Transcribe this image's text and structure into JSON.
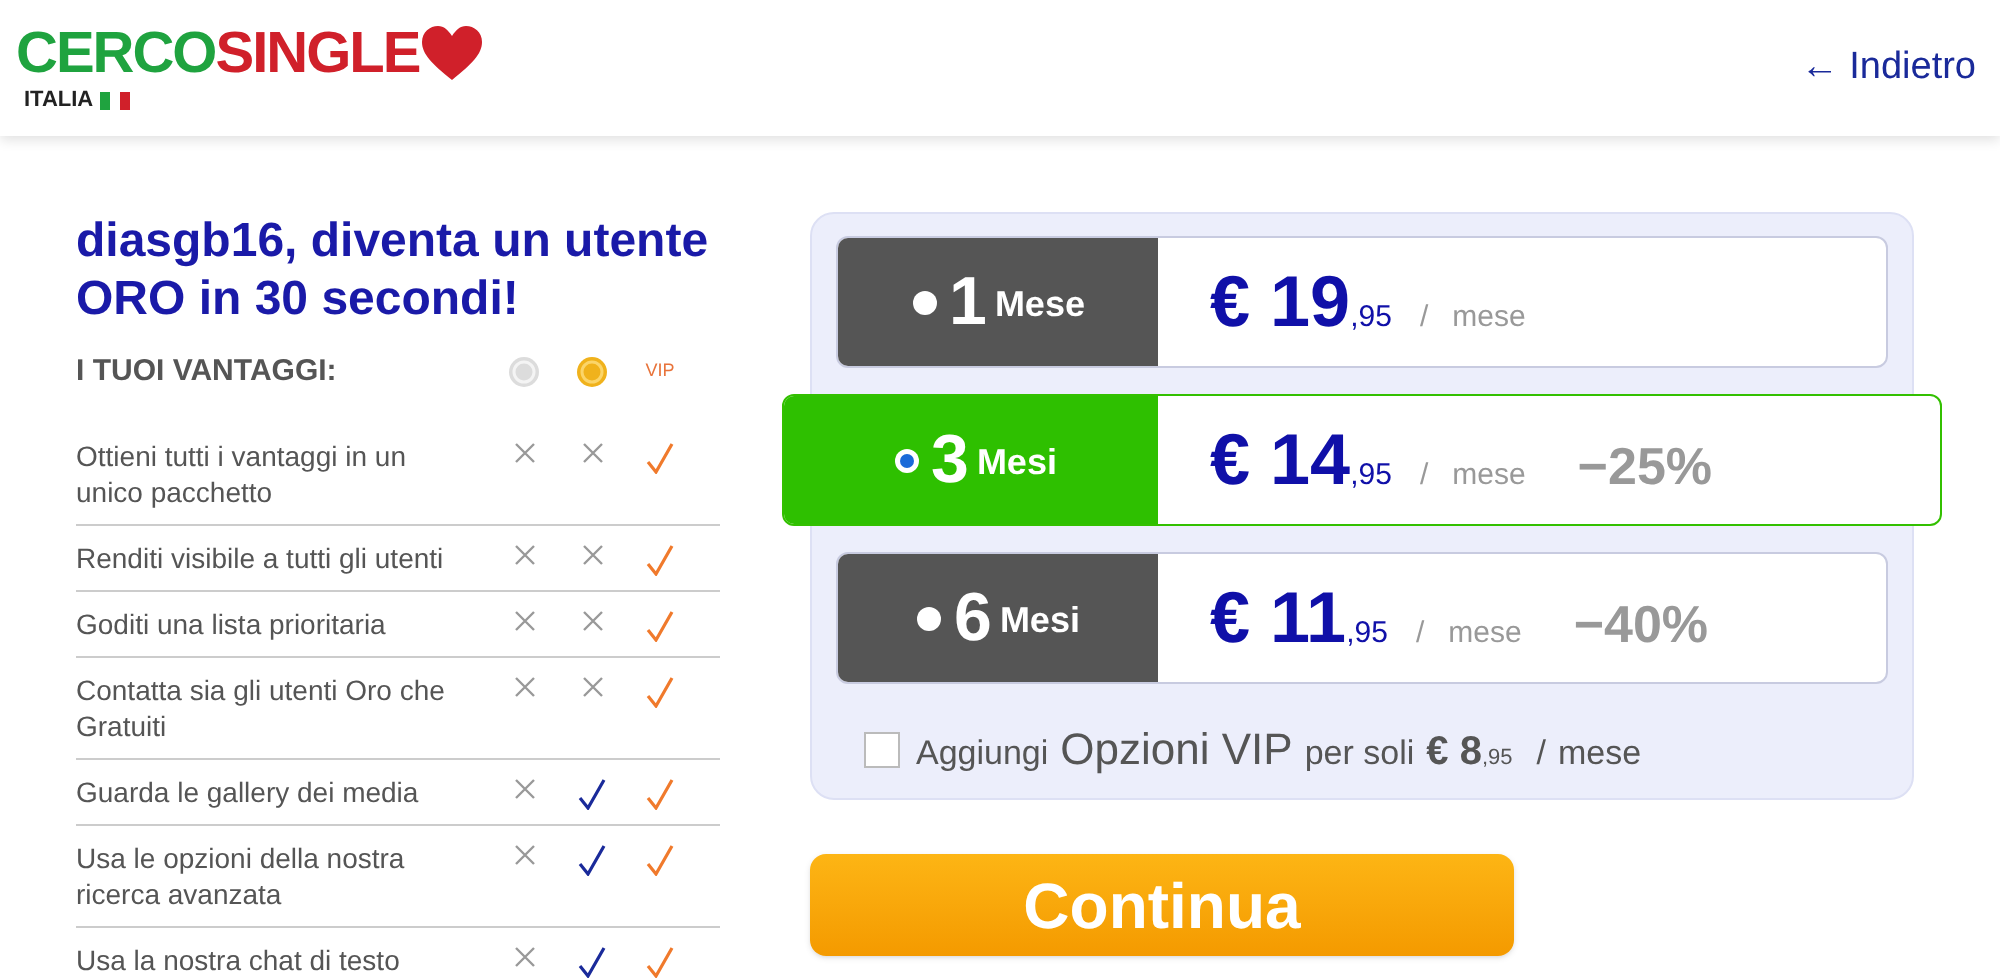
{
  "header": {
    "logo": {
      "part1": "CERCO",
      "part2": "SINGLE",
      "subtitle": "ITALIA"
    },
    "back_link": "← Indietro"
  },
  "intro": {
    "title": "diasgb16, diventa un utente ORO in 30 secondi!",
    "benefits_heading": "I TUOI VANTAGGI:",
    "columns": [
      {
        "kind": "silver"
      },
      {
        "kind": "gold"
      },
      {
        "kind": "label",
        "label": "VIP"
      }
    ]
  },
  "benefits": [
    {
      "text": "Ottieni tutti i vantaggi in un unico pacchetto",
      "marks": [
        false,
        false,
        true
      ]
    },
    {
      "text": "Renditi visibile a tutti gli utenti",
      "marks": [
        false,
        false,
        true
      ]
    },
    {
      "text": "Goditi una lista prioritaria",
      "marks": [
        false,
        false,
        true
      ]
    },
    {
      "text": "Contatta sia gli utenti Oro che Gratuiti",
      "marks": [
        false,
        false,
        true
      ]
    },
    {
      "text": "Guarda le gallery dei media",
      "marks": [
        false,
        true,
        true
      ]
    },
    {
      "text": "Usa le opzioni della nostra ricerca avanzata",
      "marks": [
        false,
        true,
        true
      ]
    },
    {
      "text": "Usa la nostra chat di testo",
      "marks": [
        false,
        true,
        true
      ]
    }
  ],
  "plans": [
    {
      "count": "1",
      "unit": "Mese",
      "price": "€ 19",
      "cents": ",95",
      "slash": "/",
      "per": "mese",
      "selected": false
    },
    {
      "count": "3",
      "unit": "Mesi",
      "price": "€ 14",
      "cents": ",95",
      "slash": "/",
      "per": "mese",
      "discount": "−25%",
      "selected": true
    },
    {
      "count": "6",
      "unit": "Mesi",
      "price": "€ 11",
      "cents": ",95",
      "slash": "/",
      "per": "mese",
      "discount": "−40%",
      "selected": false
    }
  ],
  "vip_addon": {
    "checked": false,
    "parts": [
      {
        "kind": "small",
        "text": "Aggiungi"
      },
      {
        "kind": "large",
        "text": "Opzioni VIP"
      },
      {
        "kind": "small",
        "text": "per soli"
      },
      {
        "kind": "price",
        "text": "€ 8"
      },
      {
        "kind": "cents",
        "text": ",95"
      },
      {
        "kind": "small",
        "text": "/"
      },
      {
        "kind": "small",
        "text": "mese"
      }
    ]
  },
  "continue_button": "Continua"
}
